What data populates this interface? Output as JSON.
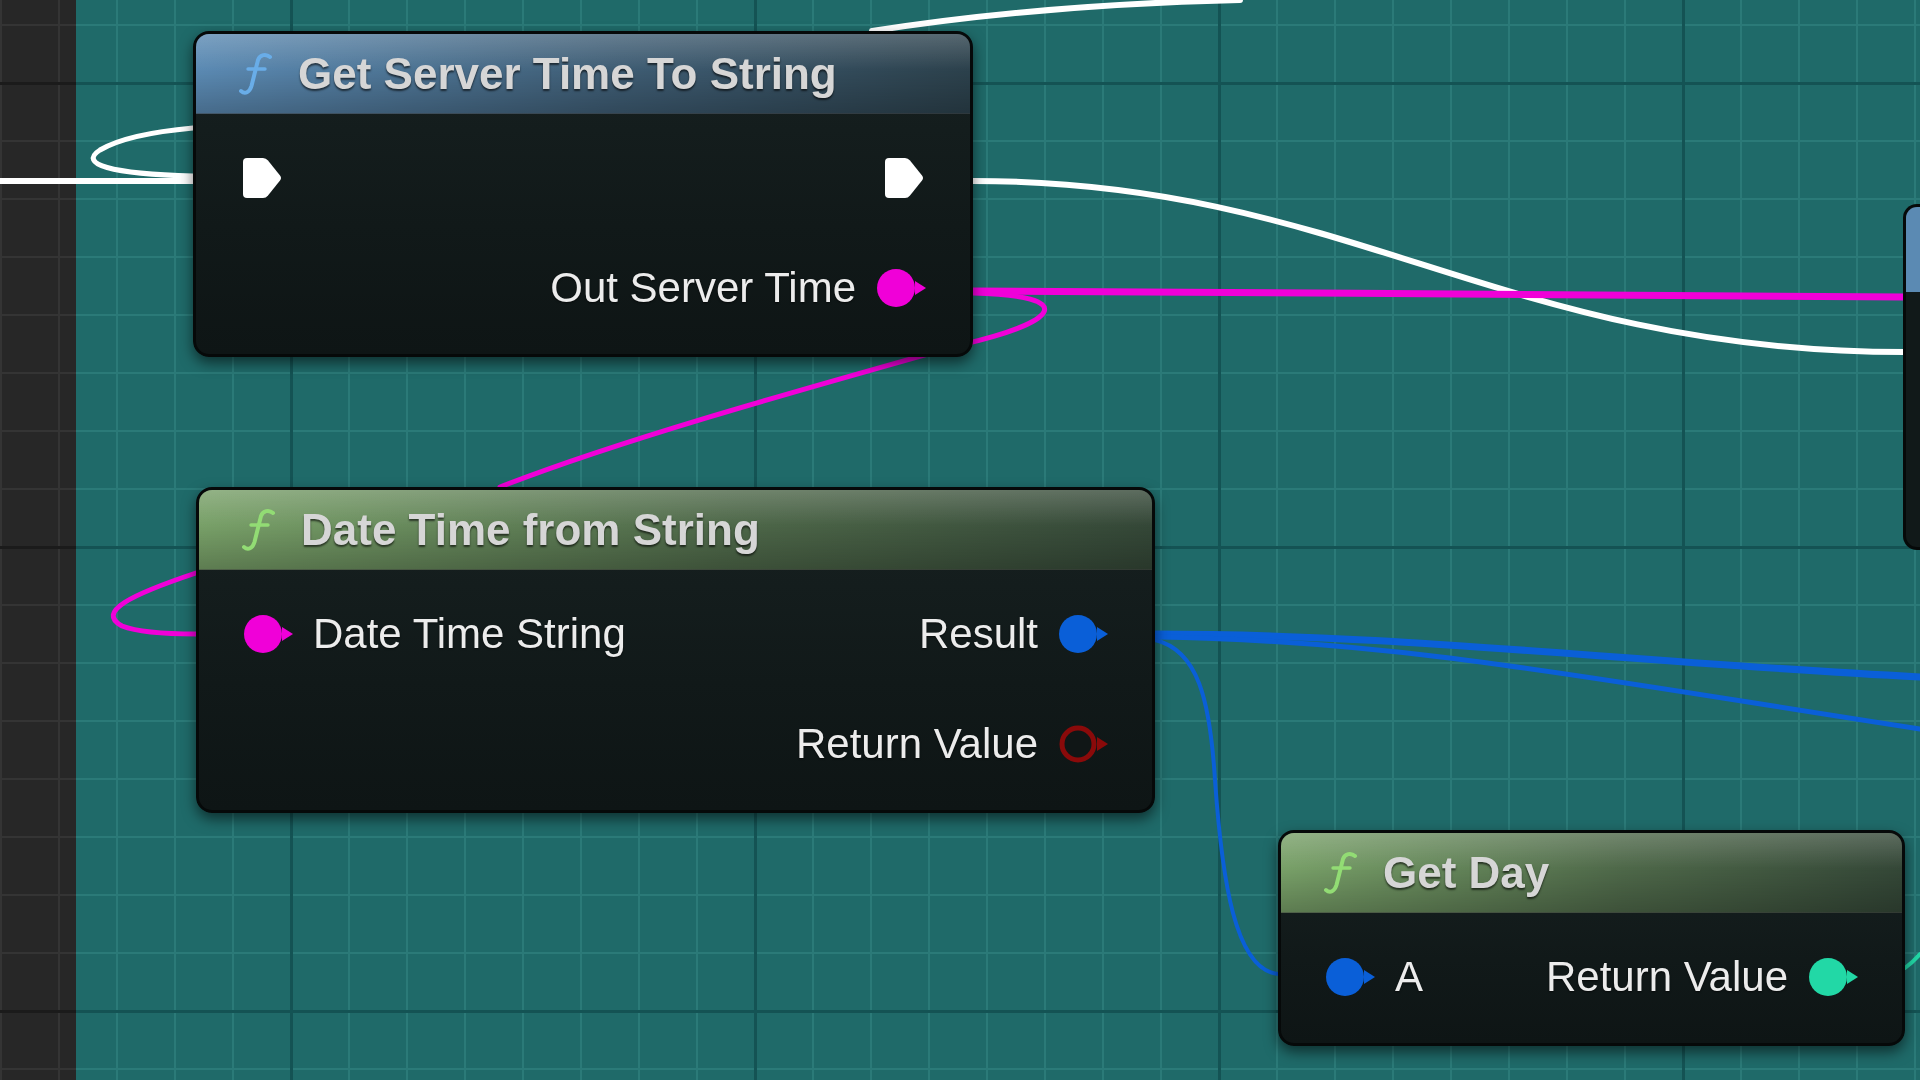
{
  "nodes": [
    {
      "title": "Get Server Time To String",
      "color": "#5b8ab3",
      "inputs": [
        {
          "kind": "exec",
          "connected": true
        }
      ],
      "outputs": [
        {
          "kind": "exec",
          "connected": true
        },
        {
          "kind": "data",
          "label": "Out Server Time",
          "color": "#f000d8",
          "connected": true
        }
      ]
    },
    {
      "title": "Date Time from String",
      "color": "#78a068",
      "inputs": [
        {
          "kind": "data",
          "label": "Date Time String",
          "color": "#f000d8",
          "connected": true
        }
      ],
      "outputs": [
        {
          "kind": "data",
          "label": "Result",
          "color": "#0a5fd8",
          "connected": true
        },
        {
          "kind": "data",
          "label": "Return Value",
          "color": "#8a0a0a",
          "connected": false
        }
      ]
    },
    {
      "title": "Get Day",
      "color": "#78a068",
      "inputs": [
        {
          "kind": "data",
          "label": "A",
          "color": "#0a5fd8",
          "connected": true
        }
      ],
      "outputs": [
        {
          "kind": "data",
          "label": "Return Value",
          "color": "#22d8a6",
          "connected": true
        }
      ]
    }
  ],
  "partial_node": {
    "color": "#5b8ab3"
  },
  "wires": [
    {
      "color": "#ffffff"
    },
    {
      "color": "#ffffff"
    },
    {
      "color": "#ffffff"
    },
    {
      "color": "#ffffff"
    },
    {
      "color": "#f000d8"
    },
    {
      "color": "#f000d8"
    },
    {
      "color": "#f000d8"
    },
    {
      "color": "#0a5fd8"
    },
    {
      "color": "#0a5fd8"
    },
    {
      "color": "#0a5fd8"
    },
    {
      "color": "#22d8a6"
    }
  ]
}
